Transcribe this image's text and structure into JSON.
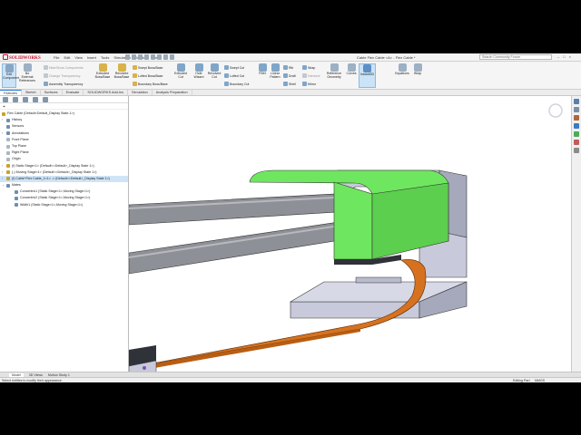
{
  "app": {
    "brand": "SOLIDWORKS",
    "document_title": "Cable Flex Cable <A> - Flex Cable *",
    "search_placeholder": "Search Community Forum",
    "menus": [
      "File",
      "Edit",
      "View",
      "Insert",
      "Tools",
      "Simulation",
      "Window",
      "Help"
    ]
  },
  "ribbon": {
    "edit_component": "Edit Component",
    "no_external_references": "No External References",
    "hide_show_components": "Hide/Show Components",
    "change_transparency": "Change Transparency",
    "assembly_transparency": "Assembly Transparency",
    "extruded_boss": "Extruded Boss/Base",
    "revolved_boss": "Revolved Boss/Base",
    "swept_boss": "Swept Boss/Base",
    "lofted_boss": "Lofted Boss/Base",
    "boundary_boss": "Boundary Boss/Base",
    "extruded_cut": "Extruded Cut",
    "hole_wizard": "Hole Wizard",
    "revolved_cut": "Revolved Cut",
    "swept_cut": "Swept Cut",
    "lofted_cut": "Lofted Cut",
    "boundary_cut": "Boundary Cut",
    "fillet": "Fillet",
    "linear_pattern": "Linear Pattern",
    "rib": "Rib",
    "draft": "Draft",
    "shell": "Shell",
    "wrap": "Wrap",
    "intersect": "Intersect",
    "mirror": "Mirror",
    "reference_geometry": "Reference Geometry",
    "curves": "Curves",
    "instant3d": "Instant3D",
    "equations": "Equations"
  },
  "command_tabs": [
    "Features",
    "Sketch",
    "Surfaces",
    "Evaluate",
    "SOLIDWORKS Add-Ins",
    "Simulation",
    "Analysis Preparation"
  ],
  "active_tab": "Features",
  "tree": {
    "filter_icon": "funnel-icon",
    "items": [
      {
        "label": "Flex Cable (Default<Default_Display State-1>)",
        "icon_color": "#c9a227"
      },
      {
        "label": "History",
        "icon_color": "#6f8fb0"
      },
      {
        "label": "Sensors",
        "icon_color": "#6f8fb0"
      },
      {
        "label": "Annotations",
        "icon_color": "#6f8fb0"
      },
      {
        "label": "Front Plane",
        "icon_color": "#aab6c3"
      },
      {
        "label": "Top Plane",
        "icon_color": "#aab6c3"
      },
      {
        "label": "Right Plane",
        "icon_color": "#aab6c3"
      },
      {
        "label": "Origin",
        "icon_color": "#aab6c3"
      },
      {
        "label": "(f) Static Stage<1> (Default<<Default>_Display State 1>)",
        "icon_color": "#c9a227"
      },
      {
        "label": "(-) Moving Stage<1> (Default<<Default>_Display State 1>)",
        "icon_color": "#c9a227"
      },
      {
        "label": "(f) Cable^Flex Cable_1<1> -> (Default<<Default>_Display State 1>)",
        "icon_color": "#c9a227"
      },
      {
        "label": "Mates",
        "icon_color": "#6f8fb0"
      },
      {
        "label": "Concentric1 (Static Stage<1>,Moving Stage<1>)",
        "icon_color": "#6f8fb0"
      },
      {
        "label": "Concentric2 (Static Stage<1>,Moving Stage<1>)",
        "icon_color": "#6f8fb0"
      },
      {
        "label": "Width1 (Static Stage<1>,Moving Stage<1>)",
        "icon_color": "#6f8fb0"
      }
    ]
  },
  "bottom_tabs": [
    "Model",
    "3D Views",
    "Motion Study 1"
  ],
  "status": {
    "message": "Select entities to modify their appearance",
    "mode": "Editing Part",
    "units": "MMGS"
  },
  "colors": {
    "block_green": "#6fe65f",
    "stage_gray": "#c8cadb",
    "cable_orange": "#d6721f",
    "rod_gray": "#8d9096"
  }
}
